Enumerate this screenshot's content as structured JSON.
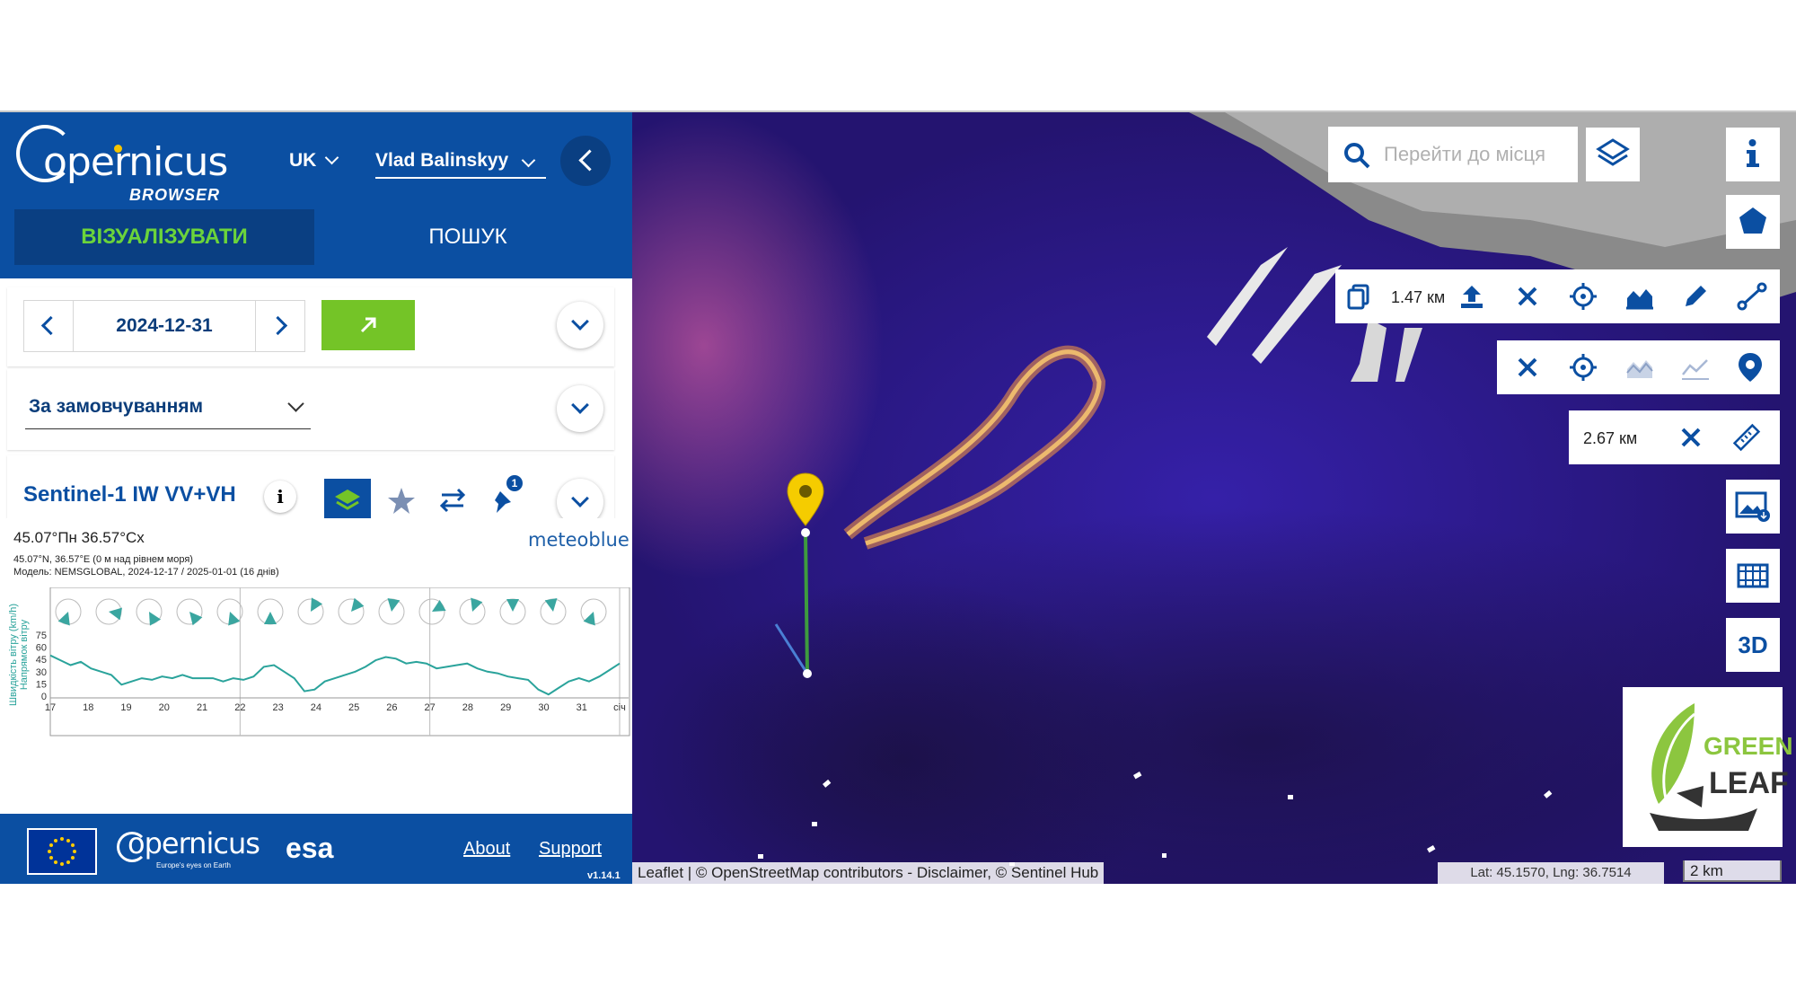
{
  "header": {
    "logo_main": "opernicus",
    "logo_sub": "BROWSER",
    "language": "UK",
    "user": "Vlad Balinskyy"
  },
  "tabs": [
    {
      "label": "ВІЗУАЛІЗУВАТИ"
    },
    {
      "label": "ПОШУК"
    }
  ],
  "date": {
    "value": "2024-12-31"
  },
  "style": {
    "selected": "За замовчуванням"
  },
  "layer": {
    "title": "Sentinel-1 IW VV+VH",
    "info": "i",
    "pins_count": "1"
  },
  "weather": {
    "title": "45.07°Пн 36.57°Сх",
    "sub1": "45.07°N, 36.57°E (0 м над рівнем моря)",
    "sub2": "Модель: NEMSGLOBAL, 2024-12-17 / 2025-01-01 (16 днів)",
    "brand": "meteoblue",
    "ylabel1": "Швидкість вітру (km/h)",
    "ylabel2": "Напрямок вітру",
    "y_ticks": [
      "75",
      "60",
      "45",
      "30",
      "15",
      "0"
    ],
    "x_ticks": [
      "17",
      "18",
      "19",
      "20",
      "21",
      "22",
      "23",
      "24",
      "25",
      "26",
      "27",
      "28",
      "29",
      "30",
      "31",
      "січ"
    ]
  },
  "chart_data": {
    "type": "line",
    "ylabel": "Швидкість вітру (km/h)",
    "ylim": [
      0,
      80
    ],
    "x_ticks": [
      "17",
      "18",
      "19",
      "20",
      "21",
      "22",
      "23",
      "24",
      "25",
      "26",
      "27",
      "28",
      "29",
      "30",
      "31",
      "січ"
    ],
    "series": [
      {
        "values": [
          50,
          44,
          38,
          42,
          34,
          30,
          26,
          14,
          18,
          22,
          20,
          24,
          22,
          26,
          22,
          22,
          22,
          18,
          22,
          20,
          24,
          36,
          38,
          30,
          22,
          6,
          8,
          18,
          22,
          26,
          30,
          36,
          44,
          48,
          46,
          40,
          42,
          40,
          34,
          36,
          38,
          40,
          34,
          30,
          28,
          24,
          22,
          20,
          8,
          2,
          10,
          18,
          22,
          18,
          24,
          32,
          40
        ]
      }
    ]
  },
  "footer": {
    "copernicus": "opernicus",
    "copernicus_sub": "Europe's eyes on Earth",
    "esa": "esa",
    "about": "About",
    "support": "Support",
    "version": "v1.14.1"
  },
  "map": {
    "search_placeholder": "Перейти до місця",
    "area_value": "1.47 км",
    "distance_value": "2.67 км",
    "btn_3d": "3D",
    "attribution": "Leaflet | © OpenStreetMap contributors - Disclaimer, © Sentinel Hub",
    "coords": "Lat: 45.1570, Lng: 36.7514",
    "scale": "2 km",
    "logo_line1": "GREEN",
    "logo_line2": "LEAF"
  },
  "colors": {
    "brand_blue": "#0b4fa2",
    "accent_green": "#74c427",
    "chart_line": "#2aa39b"
  }
}
